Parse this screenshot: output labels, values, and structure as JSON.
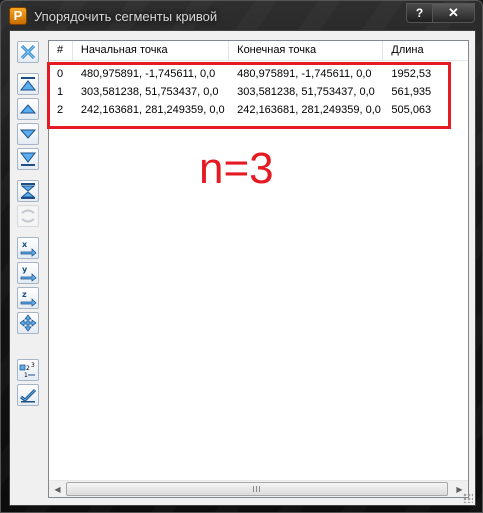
{
  "window": {
    "title": "Упорядочить сегменты кривой",
    "app_icon_letter": "P",
    "help_label": "?",
    "close_label": "✕"
  },
  "toolbar": {
    "icons": [
      "curve-reverse-icon",
      "move-top-icon",
      "move-up-icon",
      "move-down-icon",
      "move-bottom-icon",
      "reverse-order-icon",
      "swap-disabled-icon",
      "sort-x-icon",
      "sort-y-icon",
      "sort-z-icon",
      "sort-xyz-icon",
      "renumber-icon",
      "apply-check-icon"
    ]
  },
  "table": {
    "columns": [
      "#",
      "Начальная точка",
      "Конечная точка",
      "Длина"
    ],
    "rows": [
      {
        "index": "0",
        "start": "480,975891, -1,745611, 0,0",
        "end": "480,975891, -1,745611, 0,0",
        "length": "1952,53"
      },
      {
        "index": "1",
        "start": "303,581238, 51,753437, 0,0",
        "end": "303,581238, 51,753437, 0,0",
        "length": "561,935"
      },
      {
        "index": "2",
        "start": "242,163681, 281,249359, 0,0",
        "end": "242,163681, 281,249359, 0,0",
        "length": "505,063"
      }
    ]
  },
  "annotation": {
    "text": "n=3",
    "color": "#e51b24"
  }
}
